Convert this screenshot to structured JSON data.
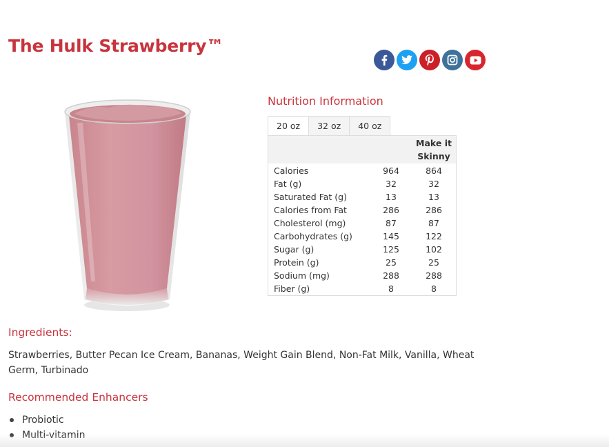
{
  "product": {
    "title": "The Hulk Strawberry™"
  },
  "social": {
    "icons": [
      "facebook-icon",
      "twitter-icon",
      "pinterest-icon",
      "instagram-icon",
      "youtube-icon"
    ],
    "colors": {
      "facebook": "#3b5998",
      "twitter": "#1da1f2",
      "pinterest": "#cb2027",
      "instagram": "#3f729b",
      "youtube": "#d8262f"
    }
  },
  "nutrition": {
    "heading": "Nutrition Information",
    "tabs": [
      "20 oz",
      "32 oz",
      "40 oz"
    ],
    "active_tab": "20 oz",
    "column_skinny_line1": "Make it",
    "column_skinny_line2": "Skinny",
    "rows": [
      {
        "label": "Calories",
        "value": "964",
        "skinny": "864"
      },
      {
        "label": "Fat (g)",
        "value": "32",
        "skinny": "32"
      },
      {
        "label": "Saturated Fat (g)",
        "value": "13",
        "skinny": "13"
      },
      {
        "label": "Calories from Fat",
        "value": "286",
        "skinny": "286"
      },
      {
        "label": "Cholesterol (mg)",
        "value": "87",
        "skinny": "87"
      },
      {
        "label": "Carbohydrates (g)",
        "value": "145",
        "skinny": "122"
      },
      {
        "label": "Sugar (g)",
        "value": "125",
        "skinny": "102"
      },
      {
        "label": "Protein (g)",
        "value": "25",
        "skinny": "25"
      },
      {
        "label": "Sodium (mg)",
        "value": "288",
        "skinny": "288"
      },
      {
        "label": "Fiber (g)",
        "value": "8",
        "skinny": "8"
      }
    ]
  },
  "ingredients": {
    "heading": "Ingredients:",
    "text": "Strawberries, Butter Pecan Ice Cream, Bananas, Weight Gain Blend, Non-Fat Milk, Vanilla, Wheat Germ, Turbinado"
  },
  "enhancers": {
    "heading": "Recommended Enhancers",
    "items": [
      "Probiotic",
      "Multi-vitamin"
    ]
  },
  "colors": {
    "accent": "#c8343d",
    "smoothie": "#d59aa1"
  }
}
